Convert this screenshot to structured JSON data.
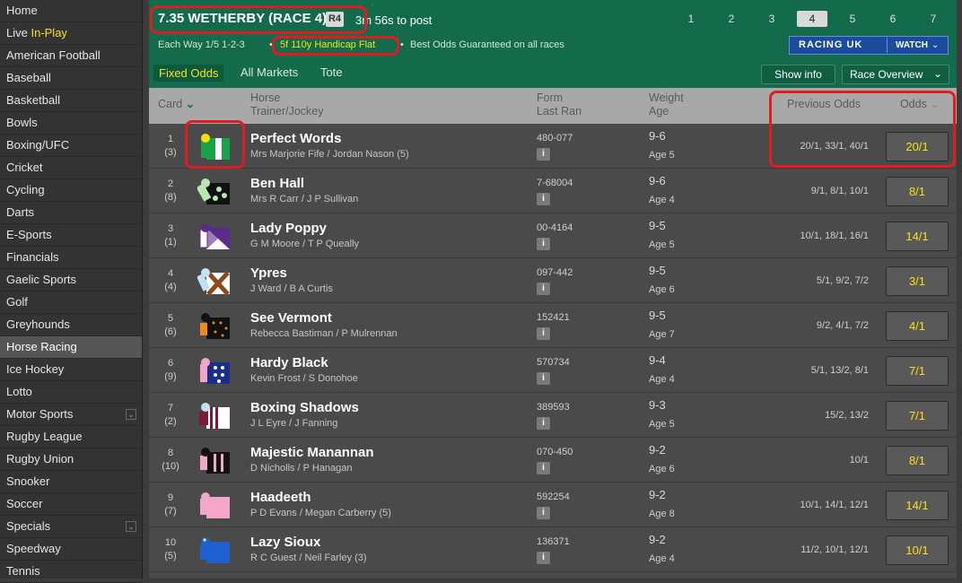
{
  "sidebar": {
    "items": [
      {
        "label": "Home"
      },
      {
        "label": "Live ",
        "highlight": "In-Play"
      },
      {
        "label": "American Football"
      },
      {
        "label": "Baseball"
      },
      {
        "label": "Basketball"
      },
      {
        "label": "Bowls"
      },
      {
        "label": "Boxing/UFC"
      },
      {
        "label": "Cricket"
      },
      {
        "label": "Cycling"
      },
      {
        "label": "Darts"
      },
      {
        "label": "E-Sports"
      },
      {
        "label": "Financials"
      },
      {
        "label": "Gaelic Sports"
      },
      {
        "label": "Golf"
      },
      {
        "label": "Greyhounds"
      },
      {
        "label": "Horse Racing",
        "active": true
      },
      {
        "label": "Ice Hockey"
      },
      {
        "label": "Lotto"
      },
      {
        "label": "Motor Sports",
        "expand": true
      },
      {
        "label": "Rugby League"
      },
      {
        "label": "Rugby Union"
      },
      {
        "label": "Snooker"
      },
      {
        "label": "Soccer"
      },
      {
        "label": "Specials",
        "expand": true
      },
      {
        "label": "Speedway"
      },
      {
        "label": "Tennis"
      }
    ]
  },
  "header": {
    "title": "7.35 WETHERBY (RACE 4)",
    "badge": "R4",
    "time_to_post": "3m 56s to post",
    "race_tabs": [
      "1",
      "2",
      "3",
      "4",
      "5",
      "6",
      "7"
    ],
    "active_race": "4",
    "each_way": "Each Way 1/5 1-2-3",
    "race_type": "5f 110y Handicap Flat",
    "bog": "Best Odds Guaranteed on all races",
    "racing_uk": "RACING UK",
    "watch": "WATCH",
    "market_tabs": [
      "Fixed Odds",
      "All Markets",
      "Tote"
    ],
    "show_info": "Show info",
    "race_overview": "Race Overview"
  },
  "columns": {
    "card": "Card",
    "horse": "Horse",
    "trainer_jockey": "Trainer/Jockey",
    "form": "Form",
    "last_ran": "Last Ran",
    "weight": "Weight",
    "age": "Age",
    "previous_odds": "Previous Odds",
    "odds": "Odds"
  },
  "runners": [
    {
      "num": "1",
      "draw": "(3)",
      "horse": "Perfect Words",
      "tj": "Mrs Marjorie Fife / Jordan Nason (5)",
      "form": "480-077",
      "weight": "9-6",
      "age": "Age 5",
      "prev": "20/1, 33/1, 40/1",
      "odds": "20/1",
      "silk": "green-white"
    },
    {
      "num": "2",
      "draw": "(8)",
      "horse": "Ben Hall",
      "tj": "Mrs R Carr / J P Sullivan",
      "form": "7-68004",
      "weight": "9-6",
      "age": "Age 4",
      "prev": "9/1, 8/1, 10/1",
      "odds": "8/1",
      "silk": "black-dots"
    },
    {
      "num": "3",
      "draw": "(1)",
      "horse": "Lady Poppy",
      "tj": "G M Moore / T P Queally",
      "form": "00-4164",
      "weight": "9-5",
      "age": "Age 5",
      "prev": "10/1, 18/1, 16/1",
      "odds": "14/1",
      "silk": "purple-white"
    },
    {
      "num": "4",
      "draw": "(4)",
      "horse": "Ypres",
      "tj": "J Ward / B A Curtis",
      "form": "097-442",
      "weight": "9-5",
      "age": "Age 6",
      "prev": "5/1,  9/2,  7/2",
      "odds": "3/1",
      "silk": "brown-cross"
    },
    {
      "num": "5",
      "draw": "(6)",
      "horse": "See Vermont",
      "tj": "Rebecca Bastiman / P Mulrennan",
      "form": "152421",
      "weight": "9-5",
      "age": "Age 7",
      "prev": "9/2, 4/1, 7/2",
      "odds": "4/1",
      "silk": "black-orange"
    },
    {
      "num": "6",
      "draw": "(9)",
      "horse": "Hardy Black",
      "tj": "Kevin Frost / S Donohoe",
      "form": "570734",
      "weight": "9-4",
      "age": "Age 4",
      "prev": "5/1, 13/2, 8/1",
      "odds": "7/1",
      "silk": "pink-navy"
    },
    {
      "num": "7",
      "draw": "(2)",
      "horse": "Boxing Shadows",
      "tj": "J L Eyre / J Fanning",
      "form": "389593",
      "weight": "9-3",
      "age": "Age 5",
      "prev": "15/2, 13/2",
      "odds": "7/1",
      "silk": "maroon-stripe"
    },
    {
      "num": "8",
      "draw": "(10)",
      "horse": "Majestic Manannan",
      "tj": "D Nicholls / P Hanagan",
      "form": "070-450",
      "weight": "9-2",
      "age": "Age 6",
      "prev": "10/1",
      "odds": "8/1",
      "silk": "black-pink"
    },
    {
      "num": "9",
      "draw": "(7)",
      "horse": "Haadeeth",
      "tj": "P D Evans / Megan Carberry (5)",
      "form": "592254",
      "weight": "9-2",
      "age": "Age 8",
      "prev": "10/1, 14/1, 12/1",
      "odds": "14/1",
      "silk": "pink"
    },
    {
      "num": "10",
      "draw": "(5)",
      "horse": "Lazy Sioux",
      "tj": "R C Guest / Neil Farley (3)",
      "form": "136371",
      "weight": "9-2",
      "age": "Age 4",
      "prev": "11/2, 10/1, 12/1",
      "odds": "10/1",
      "silk": "blue"
    }
  ]
}
